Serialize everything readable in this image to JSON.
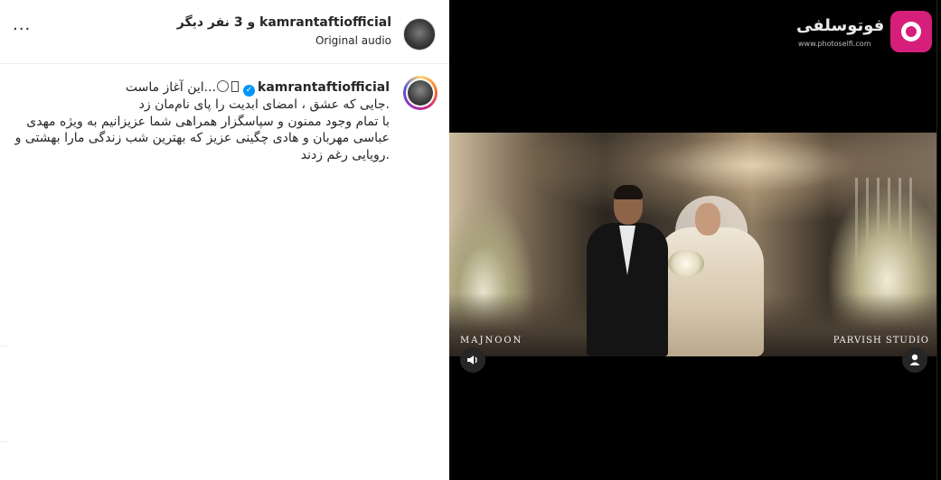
{
  "header": {
    "title": "kamrantaftiofficial و 3 نفر دیگر",
    "subtitle": "Original audio",
    "more_label": "···"
  },
  "caption": {
    "username": "kamrantaftiofficial",
    "line1_text": "...این آغاز ماست",
    "line2": ".جایی که عشق ، امضای ابدیت را پای نام‌مان زد",
    "line3": "با تمام وجود ممنون و سپاسگزار همراهی شما عزیزانیم به ویژه مهدی",
    "line4": "عباسی مهربان و هادی چگینی عزیز که بهترین شب زندگی مارا بهشتی و",
    "line5": ".رویایی رغم زدند"
  },
  "video": {
    "watermark_left": "MAJNOON",
    "watermark_right": "PARVISH STUDIO"
  },
  "logo": {
    "text": "فوتوسلفی",
    "url": "www.photoselfi.com"
  },
  "icons": {
    "more": "more-horizontal-icon",
    "verified": "verified-badge-icon",
    "ring": "ring-icon",
    "volume": "volume-icon",
    "user": "user-tag-icon"
  },
  "colors": {
    "verified": "#0095f6",
    "logo_pink": "#d61f7a"
  }
}
